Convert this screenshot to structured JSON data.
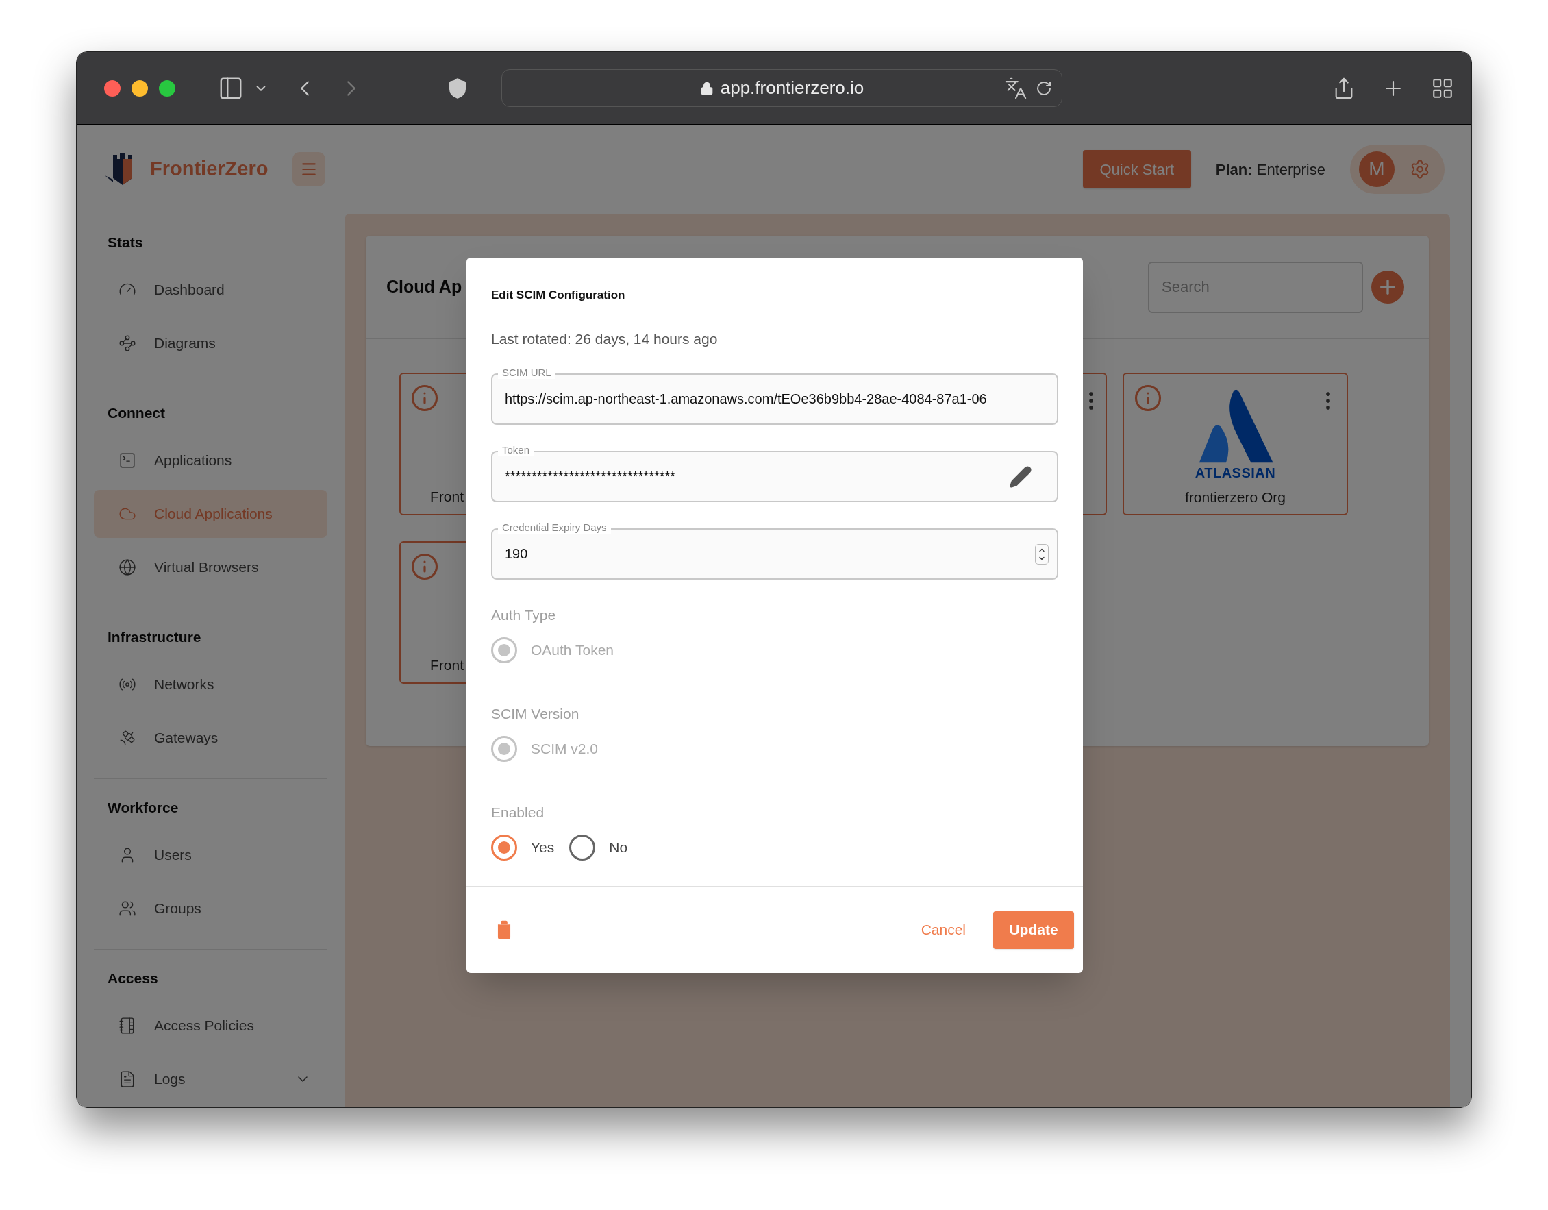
{
  "browser": {
    "url": "app.frontierzero.io"
  },
  "header": {
    "brand": "FrontierZero",
    "quick_start": "Quick Start",
    "plan": "**Plan:** Enterprise",
    "avatar": "M"
  },
  "sidebar": {
    "sections": [
      {
        "title": "Stats",
        "items": [
          {
            "kind": "link",
            "label": "Dashboard",
            "selected": false
          },
          {
            "kind": "link",
            "label": "Diagrams",
            "selected": false
          }
        ]
      },
      {
        "title": "Connect",
        "items": [
          {
            "kind": "link",
            "label": "Applications",
            "selected": false
          },
          {
            "kind": "link",
            "label": "Cloud Applications",
            "selected": true
          },
          {
            "kind": "link",
            "label": "Virtual Browsers",
            "selected": false
          }
        ]
      },
      {
        "title": "Infrastructure",
        "items": [
          {
            "kind": "link",
            "label": "Networks",
            "selected": false
          },
          {
            "kind": "link",
            "label": "Gateways",
            "selected": false
          }
        ]
      },
      {
        "title": "Workforce",
        "items": [
          {
            "kind": "link",
            "label": "Users",
            "selected": false
          },
          {
            "kind": "link",
            "label": "Groups",
            "selected": false
          }
        ]
      },
      {
        "title": "Access",
        "items": [
          {
            "kind": "link",
            "label": "Access Policies",
            "selected": false
          },
          {
            "kind": "group",
            "label": "Logs",
            "selected": false
          }
        ]
      }
    ]
  },
  "page": {
    "title": "Cloud Ap",
    "search": {
      "placeholder": "Search"
    },
    "cards": [
      {
        "kind": "clipped",
        "name": "Front"
      },
      {
        "kind": "edge"
      },
      {
        "kind": "logo",
        "logo_text": "ATLASSIAN",
        "name": "frontierzero Org"
      },
      {
        "kind": "clipped",
        "name": "Front"
      }
    ]
  },
  "dialog": {
    "title": "Edit SCIM Configuration",
    "last_rotated": "Last rotated: 26 days, 14 hours ago",
    "fields": [
      {
        "kind": "text",
        "label": "SCIM URL",
        "value": "https://scim.ap-northeast-1.amazonaws.com/tEOe36b9bb4-28ae-4084-87a1-06"
      },
      {
        "kind": "secret",
        "label": "Token",
        "value": "********************************"
      },
      {
        "kind": "number",
        "label": "Credential Expiry Days",
        "value": "190"
      }
    ],
    "radio_groups": [
      {
        "label": "Auth Type",
        "options": [
          {
            "label": "OAuth Token",
            "selected": true,
            "disabled": true
          }
        ]
      },
      {
        "label": "SCIM Version",
        "options": [
          {
            "label": "SCIM v2.0",
            "selected": true,
            "disabled": true
          }
        ]
      },
      {
        "label": "Enabled",
        "options": [
          {
            "label": "Yes",
            "selected": true,
            "disabled": false
          },
          {
            "label": "No",
            "selected": false,
            "disabled": false
          }
        ]
      }
    ],
    "cancel": "Cancel",
    "update": "Update"
  }
}
